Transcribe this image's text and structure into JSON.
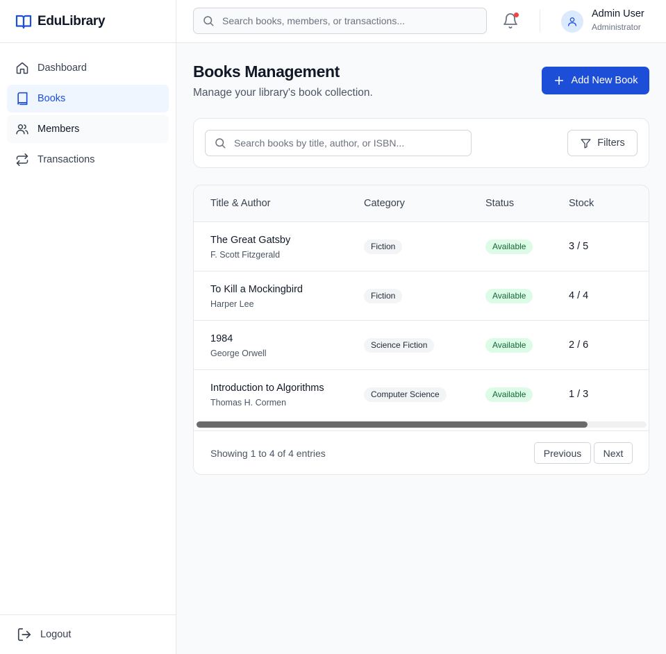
{
  "brand": {
    "name": "EduLibrary",
    "icon": "book-open-icon",
    "accent": "#1d4ed8"
  },
  "sidebar": {
    "items": [
      {
        "label": "Dashboard",
        "icon": "home-icon"
      },
      {
        "label": "Books",
        "icon": "book-icon",
        "active": true
      },
      {
        "label": "Members",
        "icon": "users-icon"
      },
      {
        "label": "Transactions",
        "icon": "arrows-exchange-icon"
      }
    ],
    "logout_label": "Logout"
  },
  "header": {
    "search_placeholder": "Search books, members, or transactions...",
    "notification_icon": "bell-icon",
    "user": {
      "name": "Admin User",
      "role": "Administrator"
    }
  },
  "main": {
    "title": "Books Management",
    "subtitle": "Manage your library's book collection.",
    "add_button_label": "Add New Book",
    "search_placeholder": "Search books by title, author, or ISBN...",
    "filters_label": "Filters",
    "table": {
      "columns": [
        "Title & Author",
        "Category",
        "Status",
        "Stock"
      ],
      "rows": [
        {
          "title": "The Great Gatsby",
          "author": "F. Scott Fitzgerald",
          "category": "Fiction",
          "status": "Available",
          "stock": "3 / 5"
        },
        {
          "title": "To Kill a Mockingbird",
          "author": "Harper Lee",
          "category": "Fiction",
          "status": "Available",
          "stock": "4 / 4"
        },
        {
          "title": "1984",
          "author": "George Orwell",
          "category": "Science Fiction",
          "status": "Available",
          "stock": "2 / 6"
        },
        {
          "title": "Introduction to Algorithms",
          "author": "Thomas H. Cormen",
          "category": "Computer Science",
          "status": "Available",
          "stock": "1 / 3"
        }
      ],
      "footer_text": "Showing 1 to 4 of 4 entries",
      "prev_label": "Previous",
      "next_label": "Next"
    }
  },
  "colors": {
    "status_available_bg": "#dcfce7",
    "status_available_text": "#166534",
    "notification_dot": "#ef4444"
  }
}
